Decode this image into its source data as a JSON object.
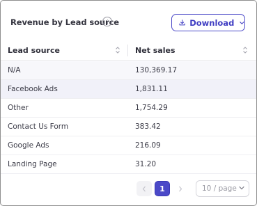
{
  "header": {
    "title": "Revenue by Lead source",
    "info_icon": "info-icon",
    "download_label": "Download"
  },
  "table": {
    "columns": [
      "Lead source",
      "Net sales"
    ],
    "rows": [
      {
        "source": "N/A",
        "sales": "130,369.17"
      },
      {
        "source": "Facebook Ads",
        "sales": "1,831.11"
      },
      {
        "source": "Other",
        "sales": "1,754.29"
      },
      {
        "source": "Contact Us Form",
        "sales": "383.42"
      },
      {
        "source": "Google Ads",
        "sales": "216.09"
      },
      {
        "source": "Landing Page",
        "sales": "31.20"
      }
    ]
  },
  "pagination": {
    "current_page": "1",
    "page_size": "10 / page"
  },
  "colors": {
    "accent": "#4b49c8",
    "border": "#8f8f8f",
    "row_hover": "#f1f1f9"
  }
}
